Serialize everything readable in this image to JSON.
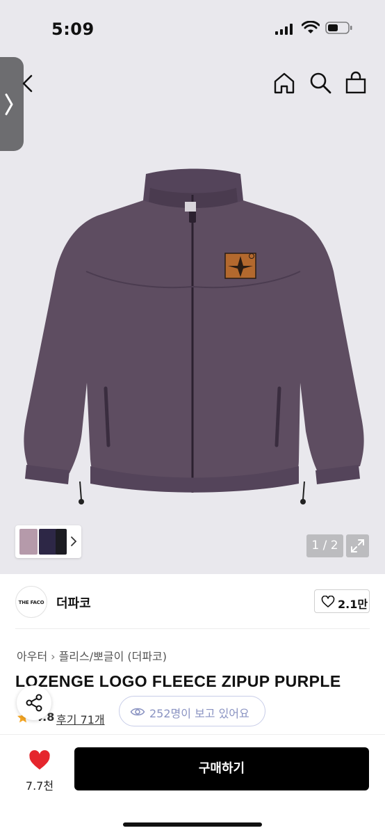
{
  "status_bar": {
    "time": "5:09",
    "icons": [
      "signal-icon",
      "wifi-icon",
      "battery-icon"
    ]
  },
  "header": {
    "icons": [
      "chevron-left-icon",
      "home-icon",
      "search-icon",
      "shopping-bag-icon"
    ]
  },
  "gallery": {
    "page_counter": "1 / 2",
    "thumbnail_colors": [
      "#b59aaa",
      "#2d2746",
      "#1c1c22"
    ],
    "product_color": "#5e4d61"
  },
  "shop": {
    "logo_text": "THE FACO",
    "name": "더파코",
    "like_count": "2.1만"
  },
  "breadcrumb": {
    "category": "아우터",
    "subcategory": "플리스/뽀글이 (더파코)"
  },
  "product": {
    "title": "LOZENGE LOGO FLEECE ZIPUP PURPLE",
    "rating": "4.8",
    "reviews": "후기 71개",
    "viewers": "252명이 보고 있어요"
  },
  "bottom_bar": {
    "like_count": "7.7천",
    "buy_label": "구매하기"
  },
  "colors": {
    "accent_black": "#000000",
    "heart_red": "#e5262d",
    "star": "#f5a623",
    "viewers_blue": "#8a93c2"
  }
}
